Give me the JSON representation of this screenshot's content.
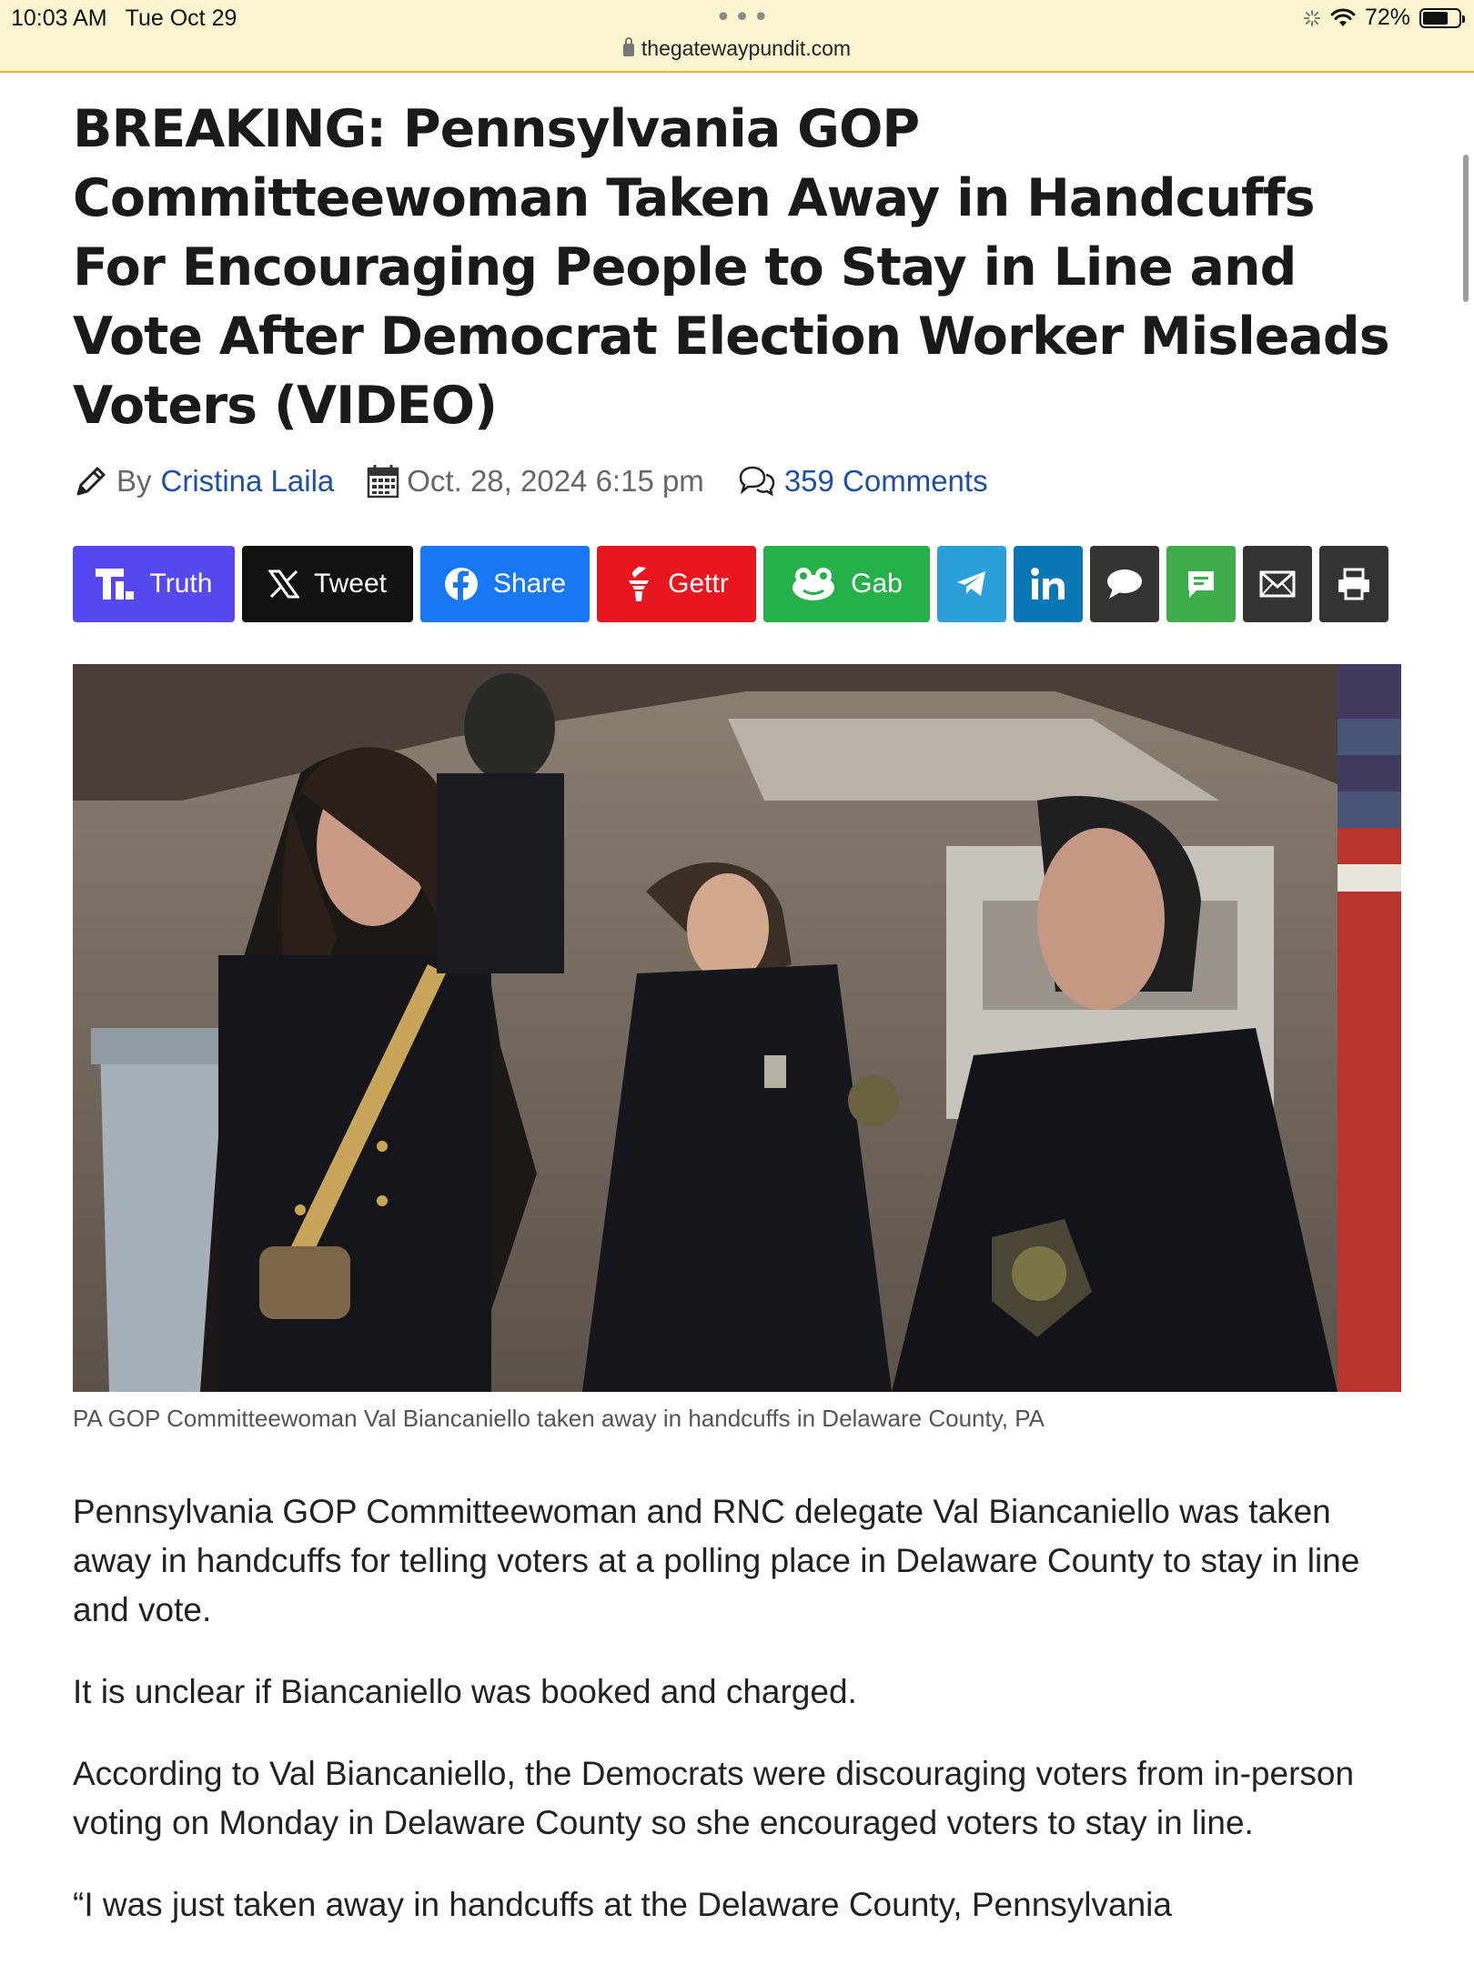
{
  "status": {
    "time": "10:03 AM",
    "date": "Tue Oct 29",
    "battery": "72%",
    "battery_level": 0.72
  },
  "browser": {
    "url": "thegatewaypundit.com"
  },
  "article": {
    "headline": "BREAKING: Pennsylvania GOP Committeewoman Taken Away in Handcuffs For Encouraging People to Stay in Line and Vote After Democrat Election Worker Misleads Voters (VIDEO)",
    "by_label": "By",
    "author": "Cristina Laila",
    "date": "Oct. 28, 2024 6:15 pm",
    "comments": "359 Comments",
    "caption": "PA GOP Committeewoman Val Biancaniello taken away in handcuffs in Delaware County, PA",
    "paragraphs": [
      "Pennsylvania GOP Committeewoman and RNC delegate Val Biancaniello was taken away in handcuffs for telling voters at a polling place in Delaware County to stay in line and vote.",
      "It is unclear if Biancaniello was booked and charged.",
      "According to Val Biancaniello, the Democrats were discouraging voters from in-person voting on Monday in Delaware County so she encouraged voters to stay in line.",
      "“I was just taken away in handcuffs at the Delaware County, Pennsylvania"
    ]
  },
  "share_buttons": [
    {
      "label": "Truth",
      "icon": "truth-social-icon",
      "color": "#5448ee"
    },
    {
      "label": "Tweet",
      "icon": "x-icon",
      "color": "#111111"
    },
    {
      "label": "Share",
      "icon": "facebook-icon",
      "color": "#1877f2"
    },
    {
      "label": "Gettr",
      "icon": "gettr-icon",
      "color": "#e8171f"
    },
    {
      "label": "Gab",
      "icon": "gab-icon",
      "color": "#25b04a"
    },
    {
      "label": "",
      "icon": "telegram-icon",
      "color": "#2a9fd8"
    },
    {
      "label": "",
      "icon": "linkedin-icon",
      "color": "#0a77b5"
    },
    {
      "label": "",
      "icon": "comment-icon",
      "color": "#333333"
    },
    {
      "label": "",
      "icon": "sms-icon",
      "color": "#3dae4a"
    },
    {
      "label": "",
      "icon": "email-icon",
      "color": "#333333"
    },
    {
      "label": "",
      "icon": "print-icon",
      "color": "#333333"
    }
  ]
}
